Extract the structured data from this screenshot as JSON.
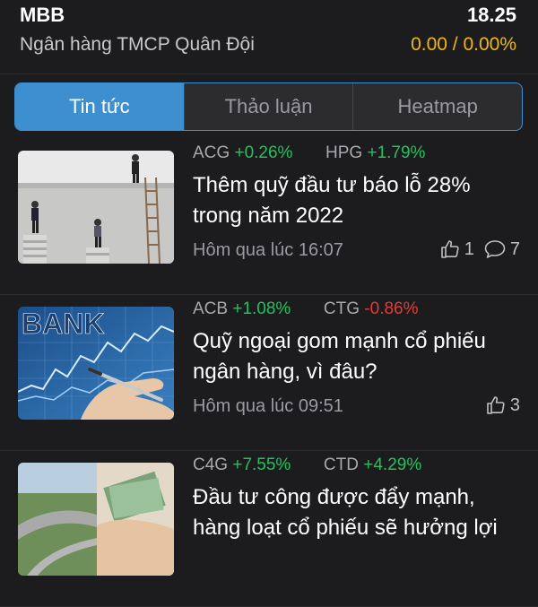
{
  "header": {
    "ticker": "MBB",
    "price": "18.25",
    "company": "Ngân hàng TMCP Quân Đội",
    "change": "0.00 / 0.00%"
  },
  "tabs": [
    {
      "label": "Tin tức",
      "active": true
    },
    {
      "label": "Thảo luận",
      "active": false
    },
    {
      "label": "Heatmap",
      "active": false
    }
  ],
  "news": [
    {
      "thumb": "business-people-wall-image",
      "tags": [
        {
          "symbol": "ACG",
          "change": "+0.26%",
          "dir": "up"
        },
        {
          "symbol": "HPG",
          "change": "+1.79%",
          "dir": "up"
        }
      ],
      "title": "Thêm quỹ đầu tư báo lỗ 28% trong năm 2022",
      "time": "Hôm qua lúc 16:07",
      "likes": "1",
      "comments": "7"
    },
    {
      "thumb": "bank-chart-hand-image",
      "thumb_text": "BANK",
      "tags": [
        {
          "symbol": "ACB",
          "change": "+1.08%",
          "dir": "up"
        },
        {
          "symbol": "CTG",
          "change": "-0.86%",
          "dir": "down"
        }
      ],
      "title": "Quỹ ngoại gom mạnh cổ phiếu ngân hàng, vì đâu?",
      "time": "Hôm qua lúc 09:51",
      "likes": "3"
    },
    {
      "thumb": "highway-money-image",
      "tags": [
        {
          "symbol": "C4G",
          "change": "+7.55%",
          "dir": "up"
        },
        {
          "symbol": "CTD",
          "change": "+4.29%",
          "dir": "up"
        }
      ],
      "title": "Đầu tư công được đẩy mạnh, hàng loạt cổ phiếu sẽ hưởng lợi"
    }
  ],
  "colors": {
    "background": "#1c1c1e",
    "accent": "#3d8fcf",
    "up": "#22c35e",
    "down": "#e53935",
    "neutral": "#f0b90b"
  }
}
